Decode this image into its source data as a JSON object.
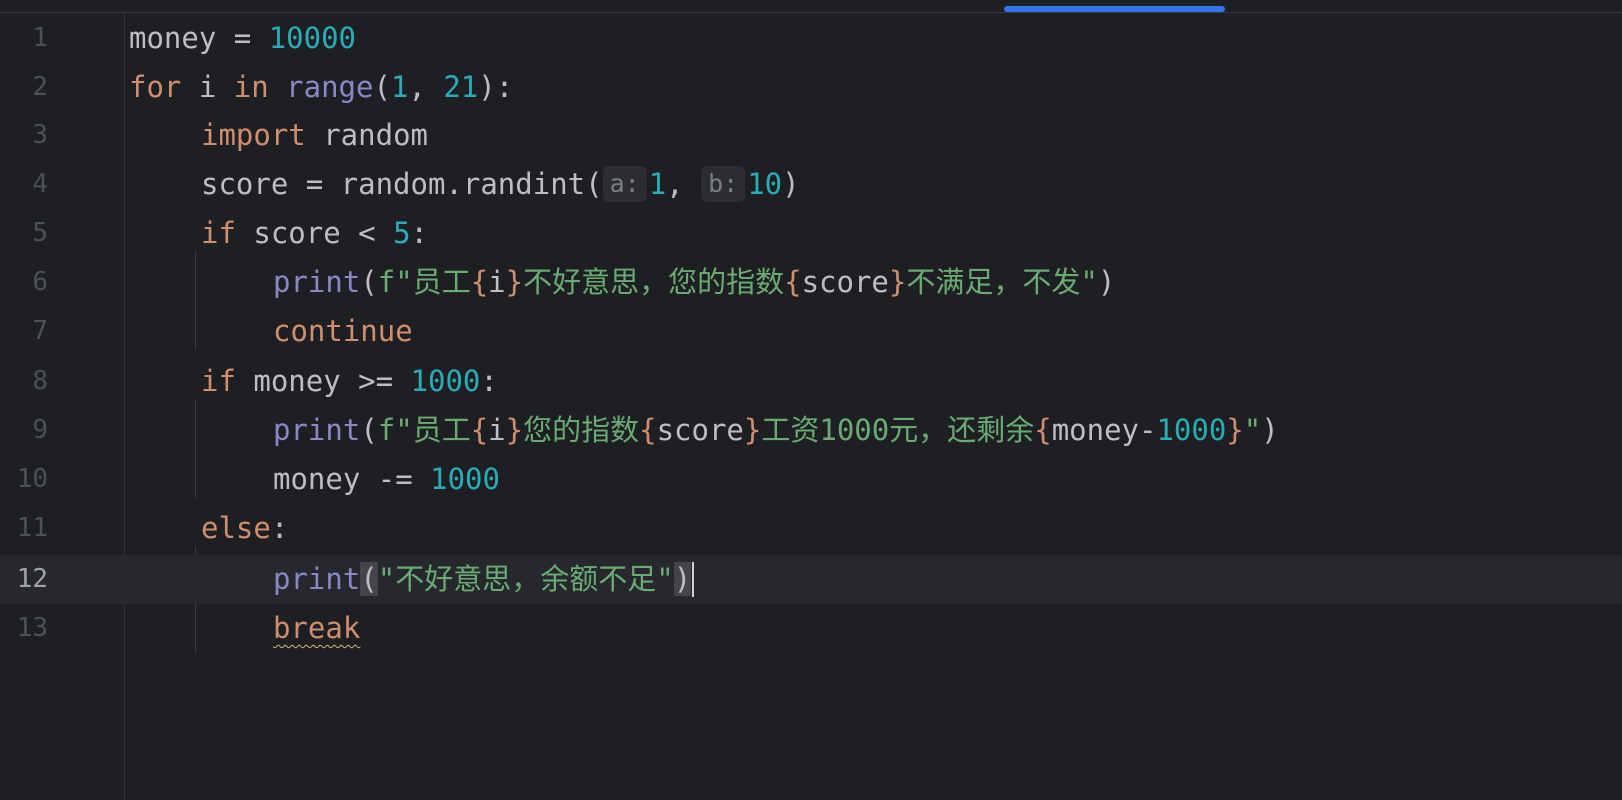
{
  "editor": {
    "language": "python",
    "current_line": 12,
    "colors": {
      "background": "#1e1f22",
      "keyword": "#cf8e6d",
      "number": "#2aacb8",
      "builtin": "#8888c6",
      "string": "#6aab73",
      "identifier": "#bcbec4",
      "line_number": "#4b5059",
      "accent": "#3574f0"
    },
    "line_numbers": [
      "1",
      "2",
      "3",
      "4",
      "5",
      "6",
      "7",
      "8",
      "9",
      "10",
      "11",
      "12",
      "13"
    ],
    "lines": [
      {
        "text": "money = 10000",
        "tokens": [
          "money",
          " = ",
          "10000"
        ]
      },
      {
        "text": "for i in range(1, 21):",
        "tokens": [
          "for",
          " i ",
          "in",
          " ",
          "range",
          "(",
          "1",
          ", ",
          "21",
          "):"
        ]
      },
      {
        "text": "    import random",
        "tokens": [
          "import",
          " random"
        ]
      },
      {
        "text": "    score = random.randint(1, 10)",
        "tokens": [
          "score = random.randint(",
          "a:",
          "1",
          ", ",
          "b:",
          "10",
          ")"
        ]
      },
      {
        "text": "    if score < 5:",
        "tokens": [
          "if",
          " score < ",
          "5",
          ":"
        ]
      },
      {
        "text": "        print(f\"员工{i}不好意思，您的指数{score}不满足，不发\")",
        "tokens": [
          "print",
          "(",
          "f\"员工",
          "{",
          "i",
          "}",
          "不好意思，您的指数",
          "{",
          "score",
          "}",
          "不满足，不发\"",
          ")"
        ]
      },
      {
        "text": "        continue",
        "tokens": [
          "continue"
        ]
      },
      {
        "text": "    if money >= 1000:",
        "tokens": [
          "if",
          " money >= ",
          "1000",
          ":"
        ]
      },
      {
        "text": "        print(f\"员工{i}您的指数{score}工资1000元，还剩余{money-1000}\")",
        "tokens": [
          "print",
          "(",
          "f\"员工",
          "{",
          "i",
          "}",
          "您的指数",
          "{",
          "score",
          "}",
          "工资1000元，还剩余",
          "{",
          "money-",
          "1000",
          "}",
          "\"",
          ")"
        ]
      },
      {
        "text": "        money -= 1000",
        "tokens": [
          "money -= ",
          "1000"
        ]
      },
      {
        "text": "    else:",
        "tokens": [
          "else",
          ":"
        ]
      },
      {
        "text": "        print(\"不好意思，余额不足\")",
        "tokens": [
          "print",
          "(",
          "\"不好意思，余额不足\"",
          ")"
        ]
      },
      {
        "text": "        break",
        "tokens": [
          "break"
        ]
      }
    ]
  }
}
